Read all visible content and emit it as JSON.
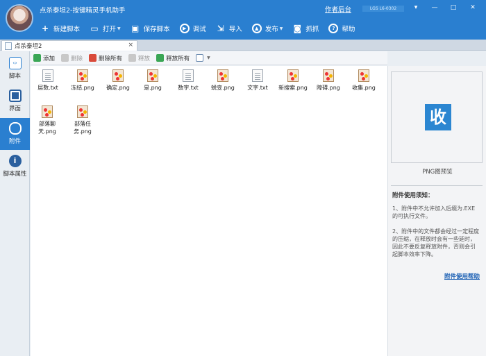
{
  "app": {
    "title": "点杀泰坦2-按键精灵手机助手",
    "author_link": "作者后台",
    "user_chip": "LGS L6-0302"
  },
  "window_controls": [
    "▾",
    "—",
    "□",
    "✕"
  ],
  "toolbar": [
    {
      "label": "新建脚本",
      "icon": "plus-icon"
    },
    {
      "label": "打开",
      "icon": "folder-icon",
      "dropdown": true
    },
    {
      "label": "保存脚本",
      "icon": "save-icon"
    },
    {
      "label": "调试",
      "icon": "play-icon"
    },
    {
      "label": "导入",
      "icon": "import-icon"
    },
    {
      "label": "发布",
      "icon": "publish-icon",
      "dropdown": true
    },
    {
      "label": "抓抓",
      "icon": "camera-icon"
    },
    {
      "label": "帮助",
      "icon": "help-icon"
    }
  ],
  "tab": {
    "label": "点杀泰坦2",
    "close": "×"
  },
  "sidebar": [
    {
      "label": "脚本",
      "icon": "script-icon",
      "active": false
    },
    {
      "label": "界面",
      "icon": "layout-icon",
      "active": false
    },
    {
      "label": "附件",
      "icon": "attachment-icon",
      "active": true
    },
    {
      "label": "脚本属性",
      "icon": "info-icon",
      "active": false
    }
  ],
  "filebar": [
    {
      "label": "添加",
      "icon": "add-icon",
      "disabled": false
    },
    {
      "label": "删除",
      "icon": "delete-icon",
      "disabled": true
    },
    {
      "label": "删除所有",
      "icon": "delete-all-icon",
      "disabled": false
    },
    {
      "label": "释放",
      "icon": "release-icon",
      "disabled": true
    },
    {
      "label": "释放所有",
      "icon": "release-all-icon",
      "disabled": false
    },
    {
      "label": "",
      "icon": "view-mode-icon",
      "disabled": false
    }
  ],
  "files": [
    {
      "name": "层数.txt",
      "type": "txt"
    },
    {
      "name": "冻结.png",
      "type": "png"
    },
    {
      "name": "确定.png",
      "type": "png"
    },
    {
      "name": "是.png",
      "type": "png"
    },
    {
      "name": "数字.txt",
      "type": "txt"
    },
    {
      "name": "蜕变.png",
      "type": "png"
    },
    {
      "name": "文字.txt",
      "type": "txt"
    },
    {
      "name": "新搜索.png",
      "type": "png"
    },
    {
      "name": "障碍.png",
      "type": "png"
    },
    {
      "name": "收集.png",
      "type": "png"
    },
    {
      "name": "部落聊天.png",
      "type": "png"
    },
    {
      "name": "部落任务.png",
      "type": "png"
    }
  ],
  "preview": {
    "glyph": "收",
    "label": "PNG图预览"
  },
  "notice": {
    "title": "附件使用须知：",
    "p1": "1、附件中不允许加入后缀为.EXE的可执行文件。",
    "p2": "2、附件中的文件都会经过一定程度的压缩，在释放时会有一些延时，因此不要反复释放附件，否则会引起脚本效率下降。",
    "help_link": "附件使用帮助"
  },
  "colors": {
    "accent": "#2a7fd0",
    "preview_glyph_bg": "#2b86d1"
  }
}
